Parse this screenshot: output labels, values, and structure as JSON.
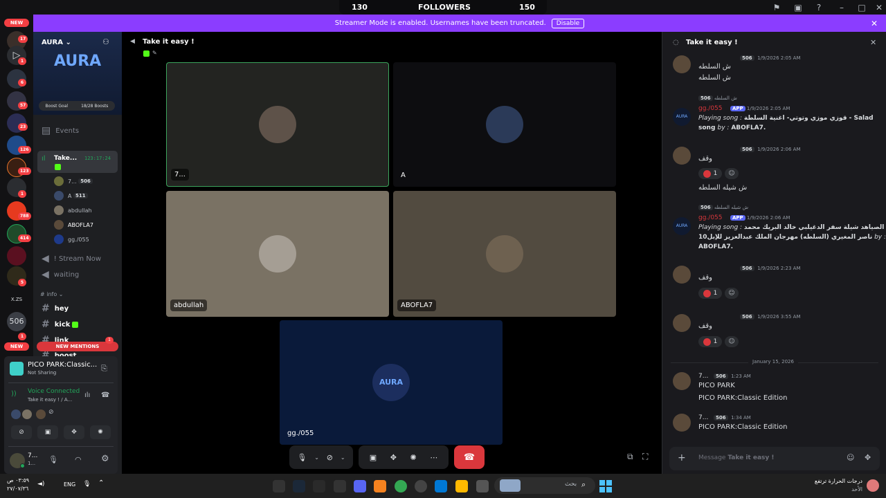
{
  "titlebar": {
    "left_count": "130",
    "followers_label": "FOLLOWERS",
    "right_count": "150"
  },
  "banner": {
    "text": "Streamer Mode is enabled. Usernames have been truncated.",
    "disable_label": "Disable"
  },
  "rail": {
    "badges": [
      "6",
      "17",
      "1",
      "6",
      "57",
      "23",
      "126",
      "123",
      "1",
      "788",
      "414",
      "5",
      "1"
    ],
    "new_top": "NEW",
    "new_bottom": "NEW",
    "xzs_label": "X.ZS",
    "server_506": "506"
  },
  "server": {
    "name": "AURA",
    "banner_text": "AURA",
    "boost_label": "Boost Goal",
    "boost_count": "18/28 Boosts",
    "events_label": "Events",
    "active_channel": {
      "name": "Take...",
      "timer": "123:17:24"
    },
    "voice_users": [
      {
        "name": "7...",
        "tag": "506",
        "color": "#6b6d3a"
      },
      {
        "name": "A",
        "tag": "511",
        "color": "#3a4a6a"
      },
      {
        "name": "abdullah",
        "tag": "",
        "color": "#7a7264"
      },
      {
        "name": "ABOFLA7",
        "tag": "",
        "color": "#5a4a3a"
      },
      {
        "name": "gg./055",
        "tag": "",
        "color": "#1e3a8a"
      }
    ],
    "stream_channel": "! Stream Now",
    "waiting_channel": "waiting",
    "category": "# info",
    "text_channels": [
      "hey",
      "kick",
      "link",
      "boost"
    ],
    "new_mentions": "NEW MENTIONS",
    "mentions_count": "1"
  },
  "panel": {
    "activity_title": "PICO PARK:Classic...",
    "activity_status": "Not Sharing",
    "voice_status": "Voice Connected",
    "voice_channel": "Take it easy ! / A...",
    "user_name": "7...",
    "user_sub": "1..."
  },
  "call": {
    "channel_title": "Take it easy !",
    "tiles": [
      {
        "name": "7...",
        "bg": "#232421",
        "avatar": "#5e5249"
      },
      {
        "name": "A",
        "bg": "#0d0d10",
        "avatar": "#2b3a58"
      },
      {
        "name": "abdullah",
        "bg": "#7a7264",
        "avatar": "#a59e94"
      },
      {
        "name": "ABOFLA7",
        "bg": "#524b40",
        "avatar": "#6e6150"
      },
      {
        "name": "gg./055",
        "bg": "#0a1a3a",
        "avatar": "#1c2e5e",
        "logo": "AURA"
      }
    ]
  },
  "chat": {
    "title": "Take it easy !",
    "messages": [
      {
        "time": "1/9/2026 2:05 AM",
        "tag": "506",
        "lines": [
          "ش السلطه",
          "ش السلطه"
        ]
      },
      {
        "reply_text": "ش السلطه",
        "reply_tag": "506",
        "author": "gg./055",
        "app": "APP",
        "time": "1/9/2026 2:05 AM",
        "prefix": "Playing song : ",
        "song": "قوزي موزي وتوتي- اغنية السلطة - Salad",
        "line2_a": "song ",
        "line2_by": "by : ",
        "line2_b": "ABOFLA7."
      },
      {
        "time": "1/9/2026 2:06 AM",
        "tag": "506",
        "lines": [
          "وقف"
        ],
        "reaction": "1"
      },
      {
        "text": "ش شيله السلطه"
      },
      {
        "reply_text": "ش شيله السلطه",
        "reply_tag": "506",
        "author": "gg./055",
        "app": "APP",
        "time": "1/9/2026 2:06 AM",
        "prefix": "Playing song : ",
        "song": "جديد الصياهد شيلة سفر الدغيلبي خالد البريك محمد",
        "line2_a": "10ناصر المغيري (السلطه) مهرجان الملك عبدالعزيز للإبل",
        "line2_by": " by : ",
        "line2_b": "ABOFLA7."
      },
      {
        "time": "1/9/2026 2:23 AM",
        "tag": "506",
        "lines": [
          "وقف"
        ],
        "reaction": "1"
      },
      {
        "time": "1/9/2026 3:55 AM",
        "tag": "506",
        "lines": [
          "وقف"
        ],
        "reaction": "1"
      },
      {
        "divider": "January 15, 2026"
      },
      {
        "author": "7...",
        "tag": "506",
        "time": "1:23 AM",
        "lines": [
          "PICO PARK",
          "PICO PARK:Classic Edition"
        ]
      },
      {
        "author": "7...",
        "tag": "506",
        "time": "1:34 AM",
        "lines": [
          "PICO PARK:Classic Edition"
        ]
      }
    ],
    "input_placeholder_prefix": "Message ",
    "input_placeholder_channel": "Take it easy !"
  },
  "taskbar": {
    "time": "٠٣:٥٩ ص",
    "date": "٢٧/٠٧/٣٦",
    "lang": "ENG",
    "search_placeholder": "بحث",
    "weather_line1": "درجات الحرارة ترتفع",
    "weather_line2": "الأحد"
  },
  "colors": {
    "accent": "#8b3dff",
    "danger": "#da373c",
    "online": "#23a55a"
  }
}
